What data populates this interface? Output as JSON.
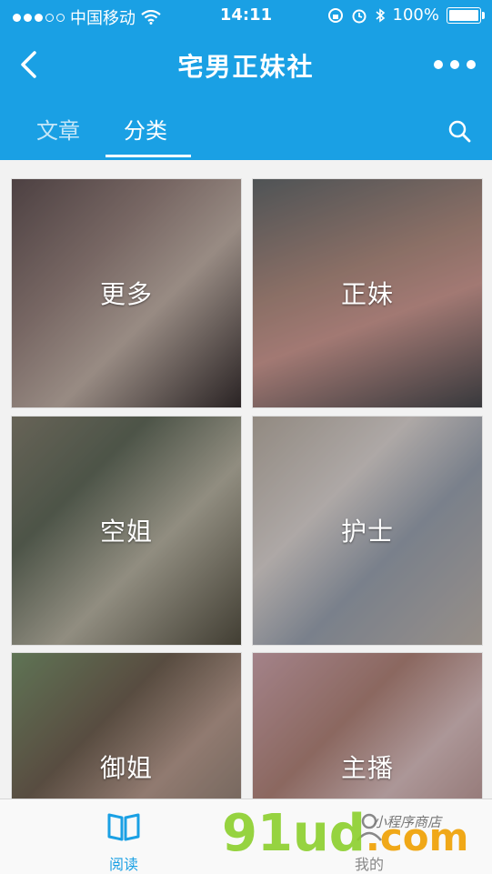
{
  "status_bar": {
    "carrier": "中国移动",
    "time": "14:11",
    "battery": "100%"
  },
  "navbar": {
    "title": "宅男正妹社"
  },
  "tabs": [
    {
      "label": "文章"
    },
    {
      "label": "分类"
    }
  ],
  "categories": [
    {
      "label": "更多"
    },
    {
      "label": "正妹"
    },
    {
      "label": "空姐"
    },
    {
      "label": "护士"
    },
    {
      "label": "御姐"
    },
    {
      "label": "主播"
    }
  ],
  "tabbar": {
    "items": [
      {
        "label": "阅读",
        "icon": "book-icon"
      },
      {
        "label": "我的",
        "icon": "user-icon"
      }
    ]
  },
  "watermark": {
    "brand": "91ud",
    "suffix": ".com",
    "tagline": "小程序商店"
  },
  "colors": {
    "accent": "#1aa0e4"
  }
}
